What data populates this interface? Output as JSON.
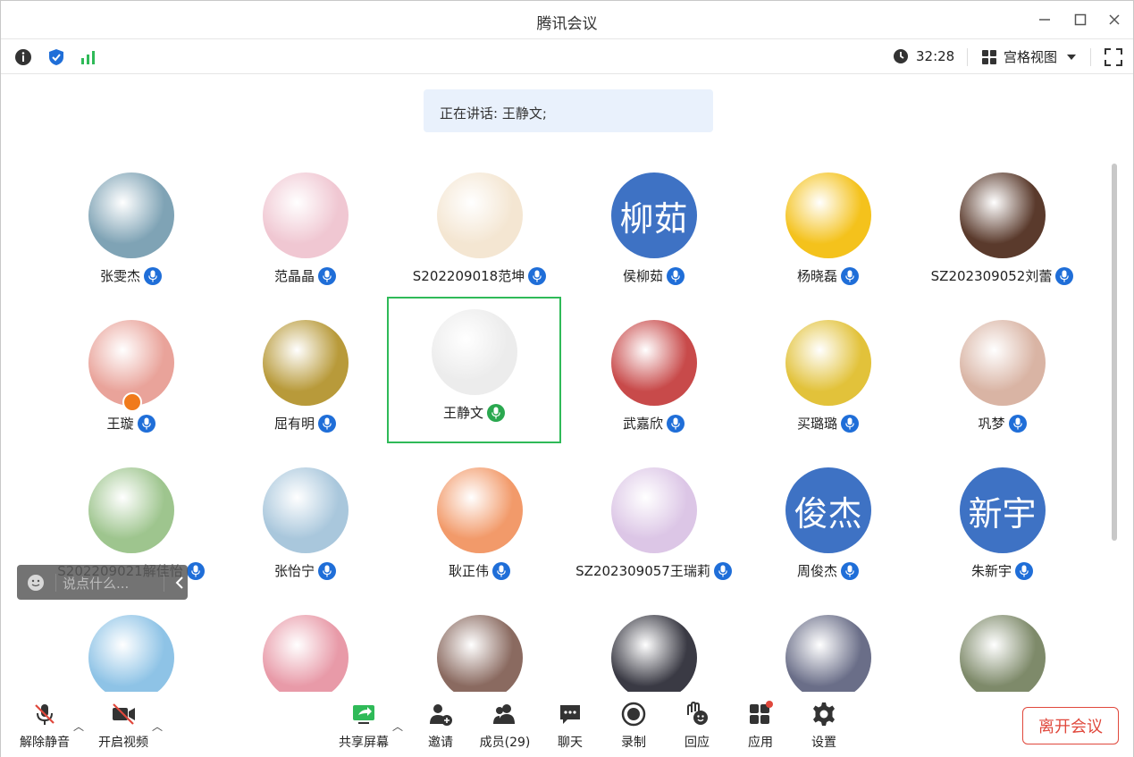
{
  "window": {
    "title": "腾讯会议"
  },
  "toolbar": {
    "timer": "32:28",
    "view_label": "宫格视图"
  },
  "speaking": {
    "text": "正在讲话: 王静文;"
  },
  "chat": {
    "placeholder": "说点什么..."
  },
  "participants": [
    {
      "name": "张雯杰",
      "avatar_kind": "photo",
      "color": "#7fa3b5",
      "muted": true
    },
    {
      "name": "范晶晶",
      "avatar_kind": "photo",
      "color": "#f0c7d2",
      "muted": true
    },
    {
      "name": "S202209018范坤",
      "avatar_kind": "photo",
      "color": "#f4e6d2",
      "muted": true
    },
    {
      "name": "侯柳茹",
      "avatar_kind": "text",
      "avatar_text": "柳茹",
      "muted": true
    },
    {
      "name": "杨晓磊",
      "avatar_kind": "photo",
      "color": "#f4c21c",
      "muted": true
    },
    {
      "name": "SZ202309052刘蕾",
      "avatar_kind": "photo",
      "color": "#5a3a2c",
      "muted": true
    },
    {
      "name": "王璇",
      "avatar_kind": "photo",
      "color": "#e9a39a",
      "muted": true,
      "host": true
    },
    {
      "name": "屈有明",
      "avatar_kind": "photo",
      "color": "#b89a3a",
      "muted": true
    },
    {
      "name": "王静文",
      "avatar_kind": "photo",
      "color": "#ececec",
      "muted": false,
      "active": true
    },
    {
      "name": "武嘉欣",
      "avatar_kind": "photo",
      "color": "#c84a4a",
      "muted": true
    },
    {
      "name": "买璐璐",
      "avatar_kind": "photo",
      "color": "#e2c23a",
      "muted": true
    },
    {
      "name": "巩梦",
      "avatar_kind": "photo",
      "color": "#d9b4a4",
      "muted": true
    },
    {
      "name": "S202209021解佳怡",
      "avatar_kind": "photo",
      "color": "#9ec58e",
      "muted": true
    },
    {
      "name": "张怡宁",
      "avatar_kind": "photo",
      "color": "#a9c7dc",
      "muted": true
    },
    {
      "name": "耿正伟",
      "avatar_kind": "photo",
      "color": "#f29a6a",
      "muted": true
    },
    {
      "name": "SZ202309057王瑞莉",
      "avatar_kind": "photo",
      "color": "#dcc6e6",
      "muted": true
    },
    {
      "name": "周俊杰",
      "avatar_kind": "text",
      "avatar_text": "俊杰",
      "muted": true
    },
    {
      "name": "朱新宇",
      "avatar_kind": "text",
      "avatar_text": "新宇",
      "muted": true
    },
    {
      "name": "",
      "avatar_kind": "photo",
      "color": "#8ec3e6",
      "muted": true
    },
    {
      "name": "",
      "avatar_kind": "photo",
      "color": "#e89aa8",
      "muted": true
    },
    {
      "name": "",
      "avatar_kind": "photo",
      "color": "#8a6a60",
      "muted": true
    },
    {
      "name": "",
      "avatar_kind": "photo",
      "color": "#3a3a44",
      "muted": true
    },
    {
      "name": "",
      "avatar_kind": "photo",
      "color": "#6a6e88",
      "muted": true
    },
    {
      "name": "",
      "avatar_kind": "photo",
      "color": "#7e8a6a",
      "muted": true
    }
  ],
  "bottom": {
    "unmute": "解除静音",
    "video": "开启视频",
    "share": "共享屏幕",
    "invite": "邀请",
    "members": "成员(29)",
    "chat": "聊天",
    "record": "录制",
    "react": "回应",
    "apps": "应用",
    "settings": "设置",
    "leave": "离开会议"
  },
  "colors": {
    "accent": "#1f6ed8",
    "active_border": "#2fba58",
    "danger": "#e0483c",
    "text_avatar": "#3e72c4"
  }
}
